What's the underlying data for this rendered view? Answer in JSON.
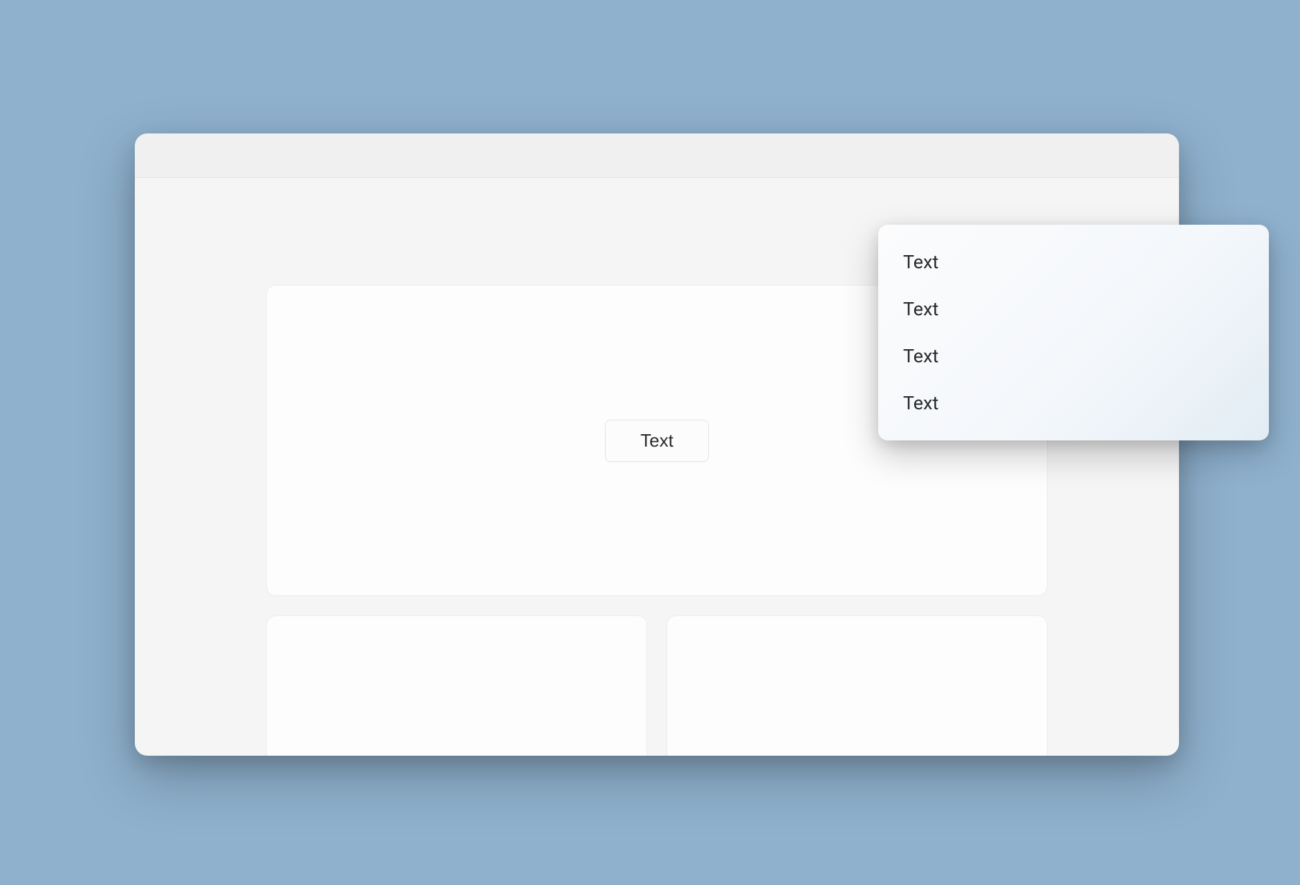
{
  "main": {
    "button_label": "Text"
  },
  "dropdown": {
    "items": [
      {
        "label": "Text"
      },
      {
        "label": "Text"
      },
      {
        "label": "Text"
      },
      {
        "label": "Text"
      }
    ]
  }
}
